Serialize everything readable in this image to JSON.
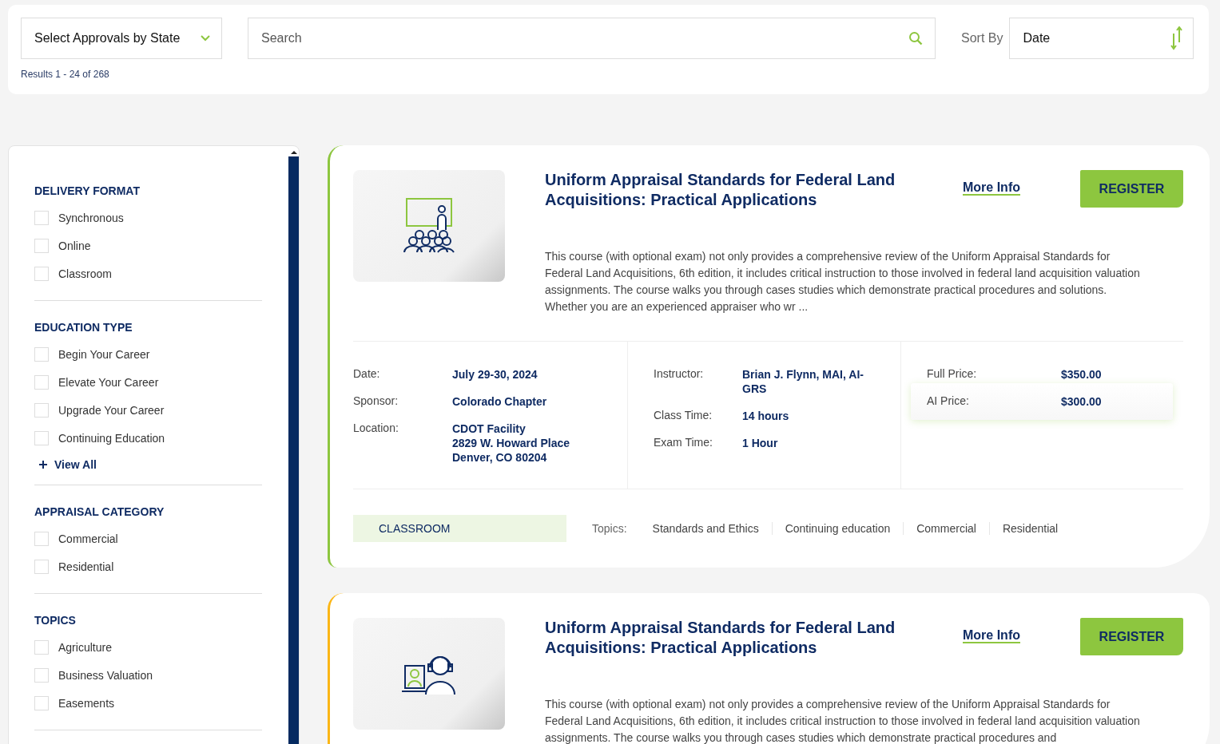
{
  "toolbar": {
    "state_select": "Select Approvals by State",
    "search": {
      "placeholder": "Search"
    },
    "sort_label": "Sort By",
    "sort_value": "Date",
    "results": "Results 1 - 24 of 268"
  },
  "filters": [
    {
      "title": "DELIVERY FORMAT",
      "options": [
        {
          "label": "Synchronous",
          "checked": false
        },
        {
          "label": "Online",
          "checked": false
        },
        {
          "label": "Classroom",
          "checked": false
        }
      ]
    },
    {
      "title": "EDUCATION TYPE",
      "options": [
        {
          "label": "Begin Your Career",
          "checked": false
        },
        {
          "label": "Elevate Your Career",
          "checked": false
        },
        {
          "label": "Upgrade Your Career",
          "checked": false
        },
        {
          "label": "Continuing Education",
          "checked": false
        }
      ],
      "view_all": "View All"
    },
    {
      "title": "APPRAISAL CATEGORY",
      "options": [
        {
          "label": "Commercial",
          "checked": false
        },
        {
          "label": "Residential",
          "checked": false
        }
      ]
    },
    {
      "title": "TOPICS",
      "options": [
        {
          "label": "Agriculture",
          "checked": false
        },
        {
          "label": "Business Valuation",
          "checked": false
        },
        {
          "label": "Easements",
          "checked": false
        }
      ]
    }
  ],
  "courses": [
    {
      "kind": "classroom",
      "color": "#8dc63f",
      "title": "Uniform Appraisal Standards for Federal Land Acquisitions: Practical Applications",
      "more_info": "More Info",
      "register": "REGISTER",
      "description": "This course (with optional exam) not only provides a comprehensive review of the Uniform Appraisal Standards for Federal Land Acquisitions, 6th edition, it includes critical instruction to those involved in federal land acquisition valuation assignments. The course walks you through cases studies which demonstrate practical procedures and solutions. Whether you are an experienced appraiser who wr ...",
      "details": [
        [
          {
            "label": "Date:",
            "value": [
              "July 29-30, 2024"
            ]
          },
          {
            "label": "Sponsor:",
            "value": [
              "Colorado Chapter"
            ]
          },
          {
            "label": "Location:",
            "value": [
              "CDOT Facility",
              "2829 W. Howard Place",
              "Denver, CO 80204"
            ]
          }
        ],
        [
          {
            "label": "Instructor:",
            "value": [
              "Brian J. Flynn, MAI, AI-GRS"
            ]
          },
          {
            "label": "Class Time:",
            "value": [
              "14 hours"
            ]
          },
          {
            "label": "Exam Time:",
            "value": [
              "1 Hour"
            ]
          }
        ]
      ],
      "prices": [
        {
          "label": "Full Price:",
          "value": "$350.00",
          "highlighted": false
        },
        {
          "label": "AI Price:",
          "value": "$300.00",
          "highlighted": true
        }
      ],
      "format_tag": "CLASSROOM",
      "topics_label": "Topics:",
      "topics": [
        "Standards and Ethics",
        "Continuing education",
        "Commercial",
        "Residential"
      ]
    },
    {
      "kind": "online",
      "color": "#fbb616",
      "title": "Uniform Appraisal Standards for Federal Land Acquisitions: Practical Applications",
      "more_info": "More Info",
      "register": "REGISTER",
      "description": "This course (with optional exam) not only provides a comprehensive review of the Uniform Appraisal Standards for Federal Land Acquisitions, 6th edition, it includes critical instruction to those involved in federal land acquisition valuation assignments. The course walks you through cases studies which demonstrate practical procedures and"
    }
  ]
}
